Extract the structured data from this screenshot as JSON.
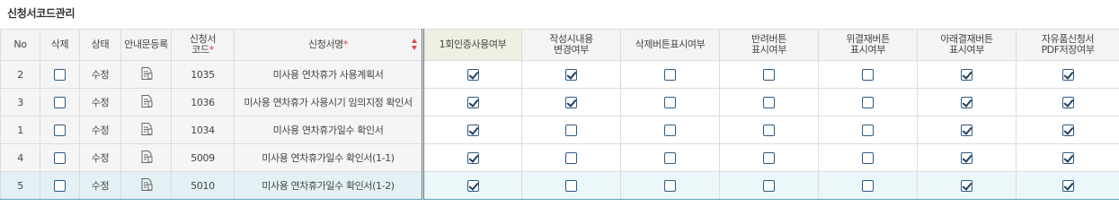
{
  "page": {
    "title": "신청서코드관리"
  },
  "columns": {
    "no": "No",
    "delete": "삭제",
    "status": "상태",
    "guide": "안내문등록",
    "code_line1": "신청서",
    "code_line2": "코드",
    "name": "신청서명",
    "auth": "1회인증사용여부",
    "edit_line1": "작성시내용",
    "edit_line2": "변경여부",
    "delbtn": "삭제버튼표시여부",
    "return_line1": "반려버튼",
    "return_line2": "표시여부",
    "delegate_line1": "위결재버튼",
    "delegate_line2": "표시여부",
    "below_line1": "아래결재버튼",
    "below_line2": "표시여부",
    "pdf_line1": "자유품신청서",
    "pdf_line2": "PDF저장여부",
    "required_mark": "*"
  },
  "rows": [
    {
      "no": "2",
      "delete": false,
      "status": "수정",
      "code": "1035",
      "name": "미사용 연차휴가 사용계획서",
      "auth": true,
      "edit": true,
      "delbtn": false,
      "ret": false,
      "delegate": false,
      "below": true,
      "pdf": true,
      "selected": false
    },
    {
      "no": "3",
      "delete": false,
      "status": "수정",
      "code": "1036",
      "name": "미사용 연차휴가 사용시기 임의지정 확인서",
      "auth": true,
      "edit": true,
      "delbtn": false,
      "ret": false,
      "delegate": false,
      "below": true,
      "pdf": true,
      "selected": false
    },
    {
      "no": "1",
      "delete": false,
      "status": "수정",
      "code": "1034",
      "name": "미사용 연차휴가일수 확인서",
      "auth": true,
      "edit": false,
      "delbtn": false,
      "ret": false,
      "delegate": false,
      "below": true,
      "pdf": true,
      "selected": false
    },
    {
      "no": "4",
      "delete": false,
      "status": "수정",
      "code": "5009",
      "name": "미사용 연차휴가일수 확인서(1-1)",
      "auth": true,
      "edit": false,
      "delbtn": false,
      "ret": false,
      "delegate": false,
      "below": true,
      "pdf": true,
      "selected": false
    },
    {
      "no": "5",
      "delete": false,
      "status": "수정",
      "code": "5010",
      "name": "미사용 연차휴가일수 확인서(1-2)",
      "auth": true,
      "edit": false,
      "delbtn": false,
      "ret": false,
      "delegate": false,
      "below": true,
      "pdf": true,
      "selected": true
    }
  ],
  "icons": {
    "guide": "document-edit-icon",
    "sort": "sort-icon"
  },
  "colors": {
    "required": "#d93a3a",
    "selected_row": "#ecf7f9",
    "highlight_header": "#eef0e2"
  }
}
